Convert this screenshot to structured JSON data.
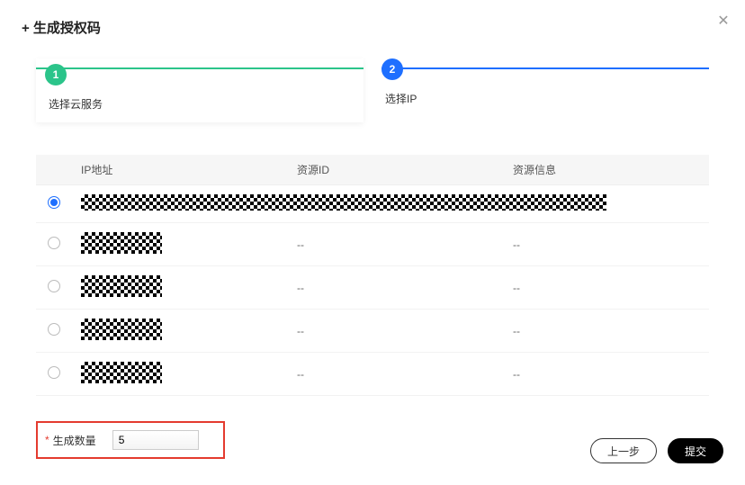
{
  "modal": {
    "title": "+ 生成授权码"
  },
  "steps": {
    "step1": {
      "num": "1",
      "label": "选择云服务"
    },
    "step2": {
      "num": "2",
      "label": "选择IP"
    }
  },
  "table": {
    "headers": {
      "ip": "IP地址",
      "resourceId": "资源ID",
      "resourceInfo": "资源信息"
    },
    "rows": [
      {
        "selected": true,
        "ip": "[redacted]",
        "resourceId": "[redacted]",
        "resourceInfo": "[redacted]"
      },
      {
        "selected": false,
        "ip": "[redacted]",
        "resourceId": "--",
        "resourceInfo": "--"
      },
      {
        "selected": false,
        "ip": "[redacted]",
        "resourceId": "--",
        "resourceInfo": "--"
      },
      {
        "selected": false,
        "ip": "[redacted]",
        "resourceId": "--",
        "resourceInfo": "--"
      },
      {
        "selected": false,
        "ip": "[redacted]",
        "resourceId": "--",
        "resourceInfo": "--"
      }
    ],
    "dash": "--"
  },
  "quantity": {
    "label": "生成数量",
    "value": "5"
  },
  "footer": {
    "prev": "上一步",
    "submit": "提交"
  }
}
